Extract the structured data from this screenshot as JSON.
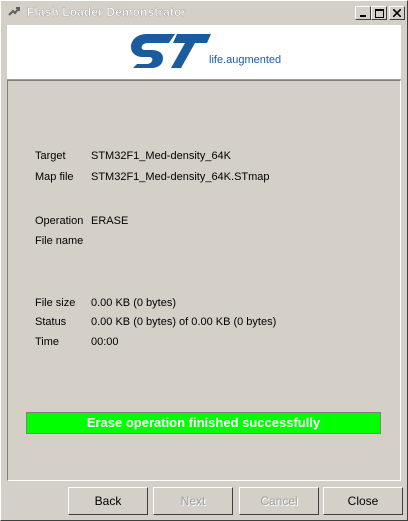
{
  "window": {
    "title": "Flash Loader Demonstrator"
  },
  "header": {
    "tagline": "life.augmented"
  },
  "info": {
    "target_label": "Target",
    "target_value": "STM32F1_Med-density_64K",
    "mapfile_label": "Map file",
    "mapfile_value": "STM32F1_Med-density_64K.STmap",
    "operation_label": "Operation",
    "operation_value": "ERASE",
    "filename_label": "File name",
    "filename_value": "",
    "filesize_label": "File size",
    "filesize_value": "0.00 KB (0 bytes)",
    "status_label": "Status",
    "status_value": "0.00 KB (0 bytes) of 0.00 KB (0 bytes)",
    "time_label": "Time",
    "time_value": "00:00"
  },
  "progress": {
    "message": "Erase operation finished successfully",
    "fraction": 1.0,
    "color": "#00ff00"
  },
  "buttons": {
    "back": "Back",
    "next": "Next",
    "cancel": "Cancel",
    "close": "Close"
  }
}
